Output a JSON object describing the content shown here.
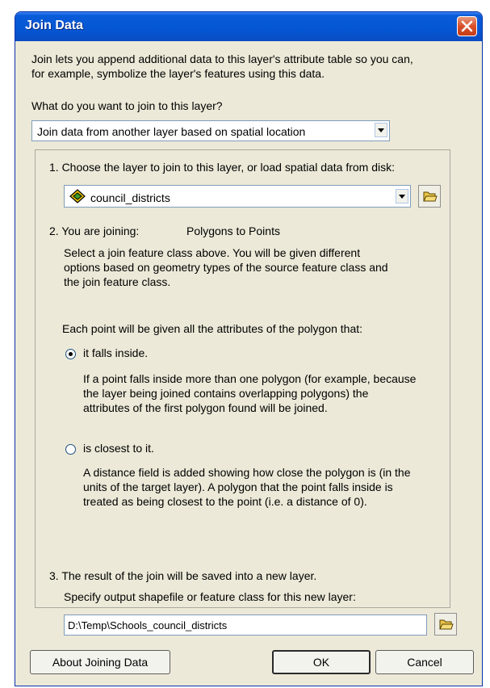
{
  "dialog": {
    "title": "Join Data",
    "description_line1": "Join lets you append additional data to this layer's attribute table so you can,",
    "description_line2": "for example, symbolize the layer's features using this data.",
    "question": "What do you want to join to this layer?",
    "join_type_selected": "Join data from another layer based on spatial location"
  },
  "step1": {
    "label": "1.  Choose the layer to join to this layer, or load spatial data from disk:",
    "layer_selected": "council_districts"
  },
  "step2": {
    "label": "2.  You are joining:",
    "join_kind": "Polygons to Points",
    "help_line1": "Select a join feature class above.  You will be given different",
    "help_line2": "options based on geometry types of the source feature class and",
    "help_line3": "the join feature class."
  },
  "options": {
    "intro": "Each point will be given all the attributes of the polygon that:",
    "opt1_label": "it falls inside.",
    "opt1_selected": true,
    "opt1_desc_line1": "If a point falls inside more than one polygon (for example, because",
    "opt1_desc_line2": "the layer being joined contains overlapping polygons) the",
    "opt1_desc_line3": "attributes of the first polygon found will be joined.",
    "opt2_label": "is closest to it.",
    "opt2_selected": false,
    "opt2_desc_line1": "A distance field is added showing how close the polygon is (in the",
    "opt2_desc_line2": "units of the target layer). A polygon that the point falls inside is",
    "opt2_desc_line3": "treated as being closest to the point (i.e. a distance of 0)."
  },
  "step3": {
    "label": "3.  The result of the join will be saved into a new layer.",
    "help": "Specify output shapefile or feature class for this new layer:",
    "output_path": "D:\\Temp\\Schools_council_districts"
  },
  "buttons": {
    "about": "About Joining Data",
    "ok": "OK",
    "cancel": "Cancel"
  },
  "icons": {
    "close": "close-icon",
    "layer": "polygon-layer-icon",
    "folder": "open-folder-icon"
  }
}
